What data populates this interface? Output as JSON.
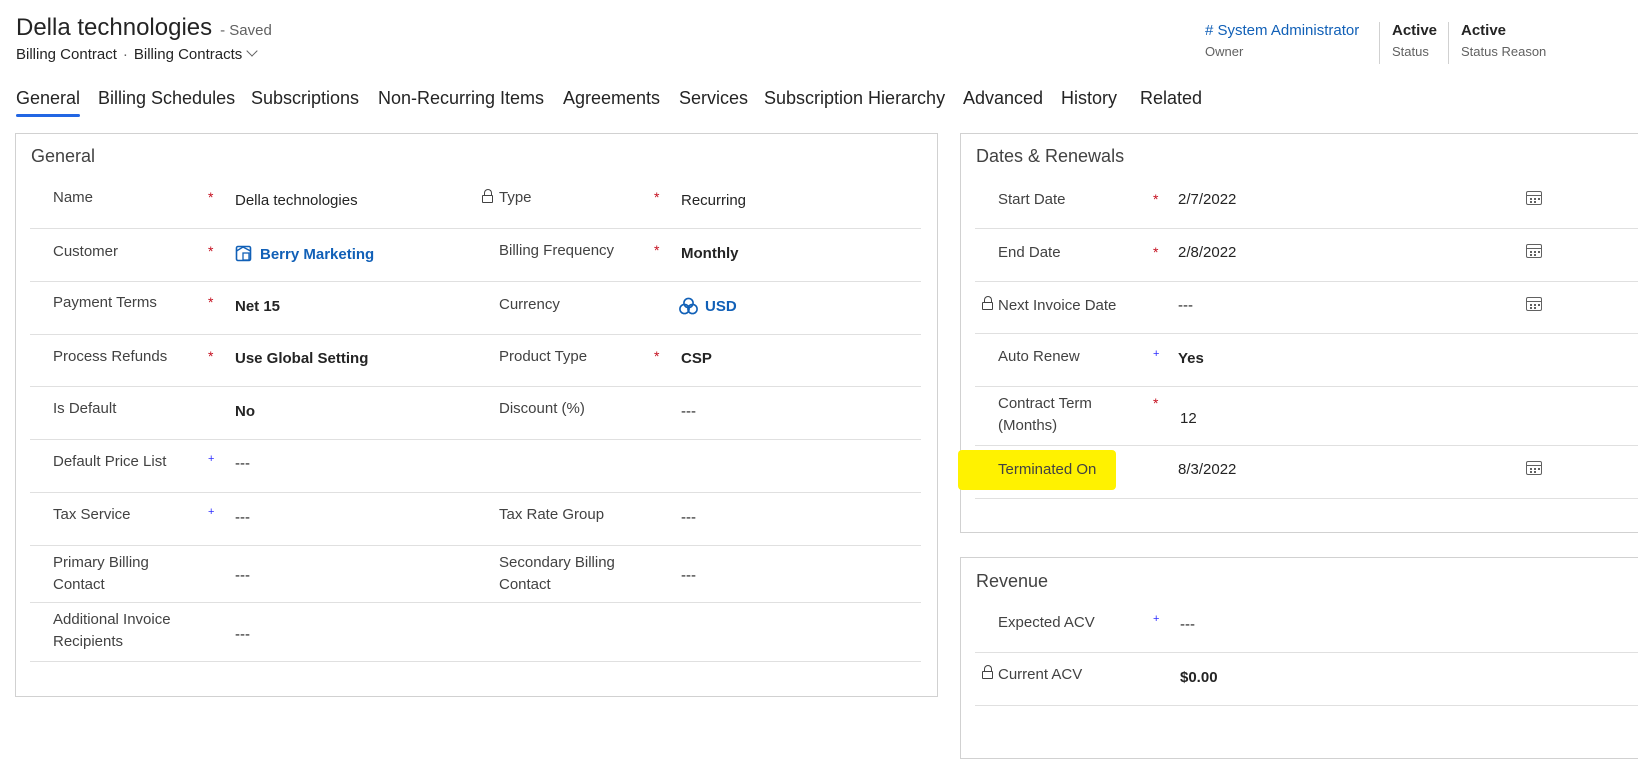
{
  "header": {
    "title": "Della technologies",
    "saved": "- Saved",
    "entity": "Billing Contract",
    "separator": "·",
    "form": "Billing Contracts",
    "owner_value": "# System Administrator",
    "owner_label": "Owner",
    "status_value": "Active",
    "status_label": "Status",
    "status_reason_value": "Active",
    "status_reason_label": "Status Reason"
  },
  "tabs": [
    "General",
    "Billing Schedules",
    "Subscriptions",
    "Non-Recurring Items",
    "Agreements",
    "Services",
    "Subscription Hierarchy",
    "Advanced",
    "History",
    "Related"
  ],
  "general": {
    "title": "General",
    "name_label": "Name",
    "name_value": "Della technologies",
    "type_label": "Type",
    "type_value": "Recurring",
    "customer_label": "Customer",
    "customer_value": "Berry Marketing",
    "billing_frequency_label": "Billing Frequency",
    "billing_frequency_value": "Monthly",
    "payment_terms_label": "Payment Terms",
    "payment_terms_value": "Net 15",
    "currency_label": "Currency",
    "currency_value": "USD",
    "process_refunds_label": "Process Refunds",
    "process_refunds_value": "Use Global Setting",
    "product_type_label": "Product Type",
    "product_type_value": "CSP",
    "is_default_label": "Is Default",
    "is_default_value": "No",
    "discount_label": "Discount (%)",
    "discount_value": "---",
    "default_price_list_label": "Default Price List",
    "default_price_list_value": "---",
    "tax_service_label": "Tax Service",
    "tax_service_value": "---",
    "tax_rate_group_label": "Tax Rate Group",
    "tax_rate_group_value": "---",
    "primary_contact_label_1": "Primary Billing",
    "primary_contact_label_2": "Contact",
    "primary_contact_value": "---",
    "secondary_contact_label_1": "Secondary Billing",
    "secondary_contact_label_2": "Contact",
    "secondary_contact_value": "---",
    "additional_recipients_label_1": "Additional Invoice",
    "additional_recipients_label_2": "Recipients",
    "additional_recipients_value": "---"
  },
  "dates": {
    "title": "Dates & Renewals",
    "start_label": "Start Date",
    "start_value": "2/7/2022",
    "end_label": "End Date",
    "end_value": "2/8/2022",
    "next_invoice_label": "Next Invoice Date",
    "next_invoice_value": "---",
    "auto_renew_label": "Auto Renew",
    "auto_renew_value": "Yes",
    "contract_term_label_1": "Contract Term",
    "contract_term_label_2": "(Months)",
    "contract_term_value": "12",
    "terminated_label": "Terminated On",
    "terminated_value": "8/3/2022"
  },
  "revenue": {
    "title": "Revenue",
    "expected_acv_label": "Expected ACV",
    "expected_acv_value": "---",
    "current_acv_label": "Current ACV",
    "current_acv_value": "$0.00"
  },
  "symbols": {
    "required": "*",
    "recommended": "+"
  },
  "colors": {
    "link": "#1160b7",
    "tab_underline": "#2266e3",
    "required": "#c50f1f",
    "highlight": "#fff200"
  }
}
